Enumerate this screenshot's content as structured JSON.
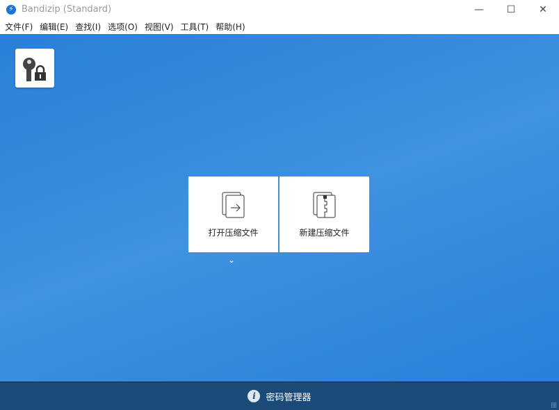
{
  "window": {
    "title": "Bandizip (Standard)",
    "minimize": "—",
    "maximize": "☐",
    "close": "✕"
  },
  "menu": [
    "文件(F)",
    "编辑(E)",
    "查找(I)",
    "选项(O)",
    "视图(V)",
    "工具(T)",
    "帮助(H)"
  ],
  "tiles": {
    "open": "打开压缩文件",
    "new": "新建压缩文件"
  },
  "dropdown_chevron": "⌄",
  "bottom": {
    "password_manager": "密码管理器",
    "info_icon": "i"
  }
}
